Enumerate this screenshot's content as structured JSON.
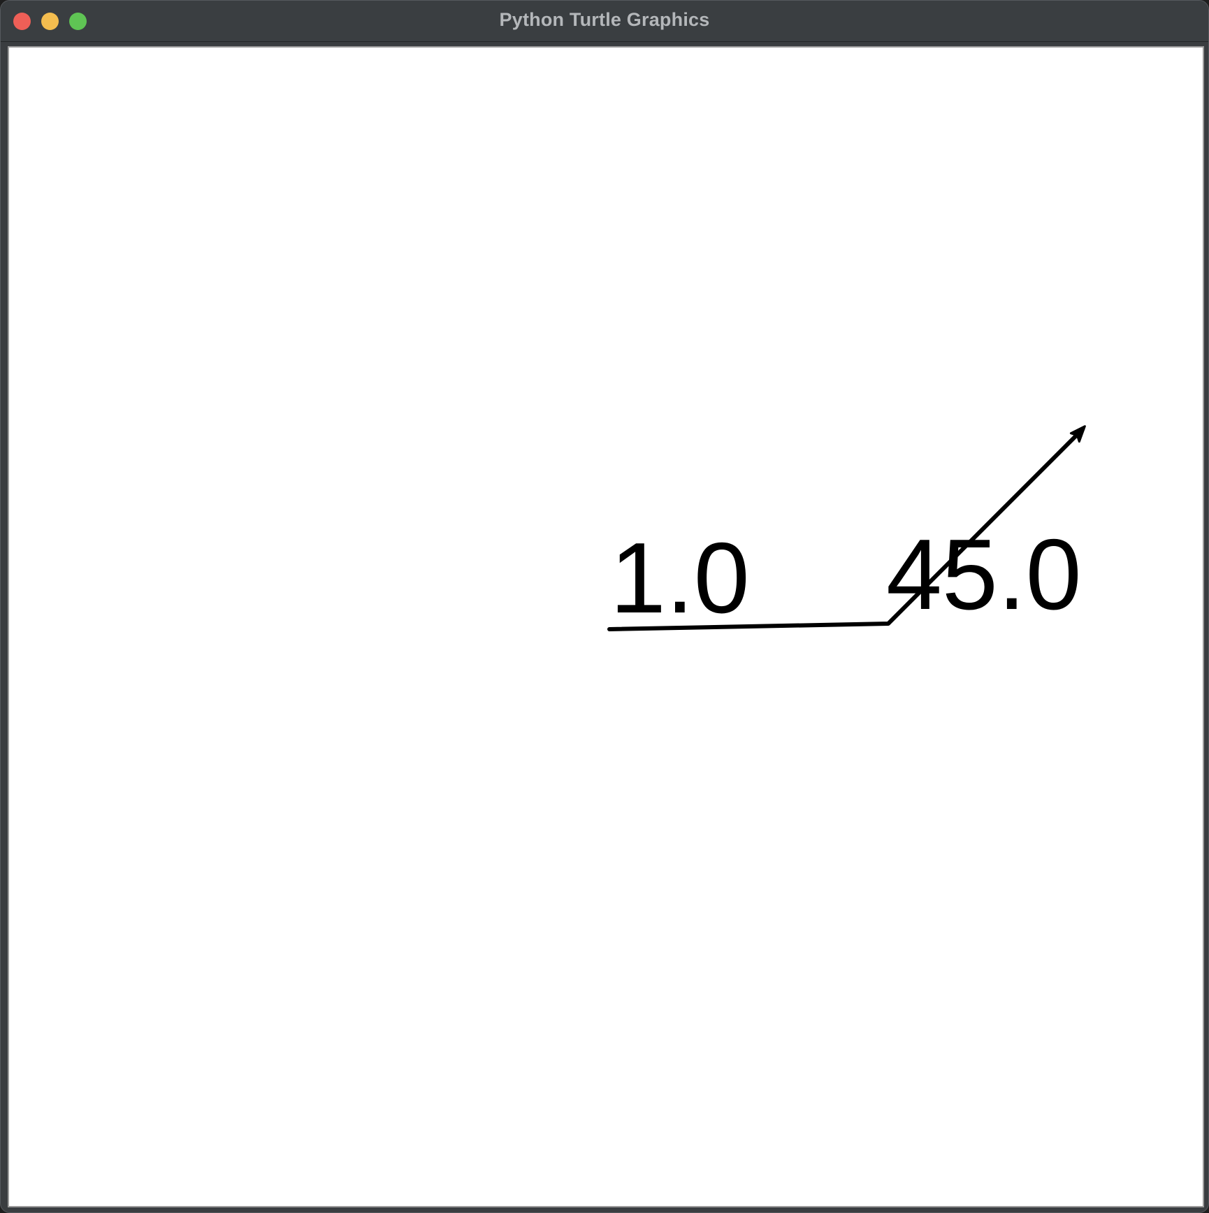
{
  "window": {
    "title": "Python Turtle Graphics"
  },
  "canvas": {
    "background": "#ffffff",
    "pen_color": "#000000",
    "labels": {
      "first": "1.0",
      "second": "45.0"
    },
    "turtle_icon": "arrow-cursor-icon"
  }
}
